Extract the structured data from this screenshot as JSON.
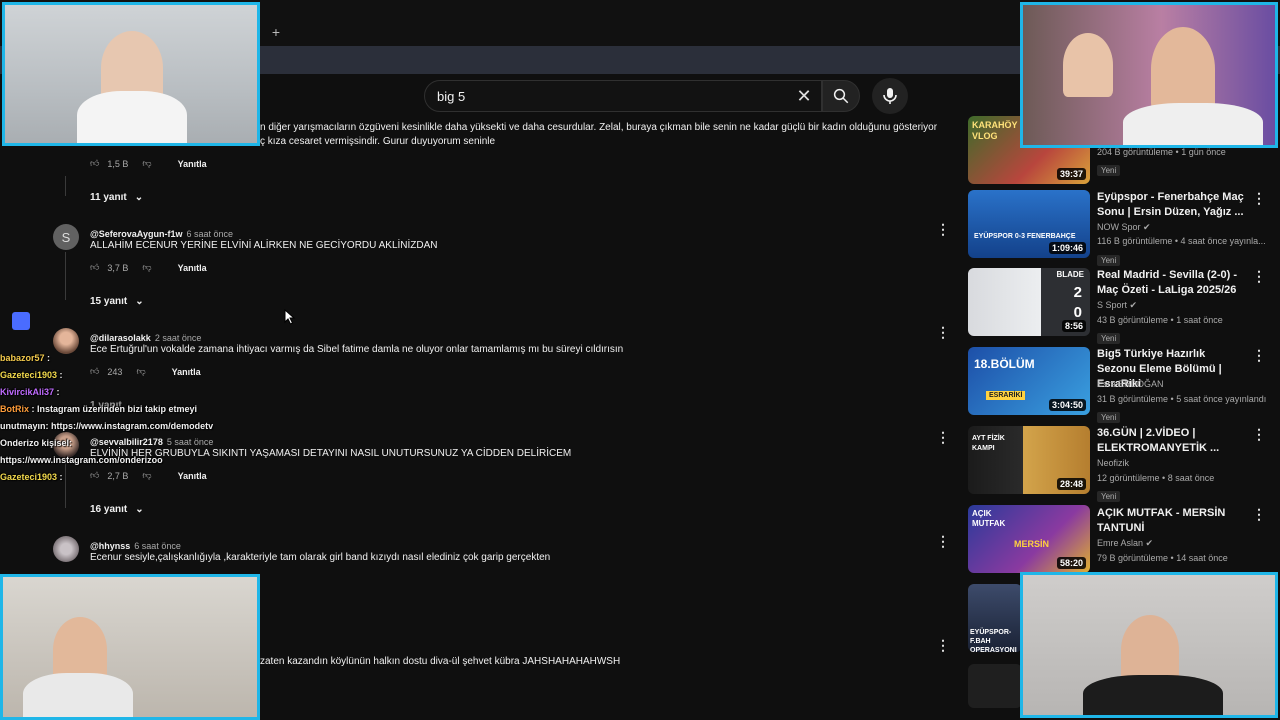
{
  "search": {
    "value": "big 5"
  },
  "comments": [
    {
      "text_line1": "n diğer yarışmacıların özgüveni kesinlikle daha yüksekti ve daha cesurdular. Zelal, buraya çıkman bile senin ne kadar güçlü bir kadın olduğunu gösteriyor",
      "text_line2": "ç kıza cesaret vermişsindir. Gurur duyuyorum seninle",
      "likes": "1,5 B",
      "reply": "Yanıtla",
      "replies": "11 yanıt"
    },
    {
      "handle": "@SeferovaAygun-f1w",
      "time": "6 saat önce",
      "avatar_letter": "S",
      "text": "ALLAHİM ECENUR YERİNE ELVİNİ ALİRKEN NE GECİYORDU AKLİNİZDAN",
      "likes": "3,7 B",
      "reply": "Yanıtla",
      "replies": "15 yanıt"
    },
    {
      "handle": "@dilarasolakk",
      "time": "2 saat önce",
      "text": "Ece Ertuğrul'un vokalde zamana ihtiyacı varmış da Sibel fatime damla ne oluyor onlar tamamlamış mı bu süreyi cıldırısın",
      "likes": "243",
      "reply": "Yanıtla",
      "replies": "1 yanıt"
    },
    {
      "handle": "@sevvalbilir2178",
      "time": "5 saat önce",
      "text": "ELVİNİN HER GRUBUYLA SIKINTI YAŞAMASI DETAYINI NASIL UNUTURSUNUZ YA CİDDEN DELİRİCEM",
      "likes": "2,7 B",
      "reply": "Yanıtla",
      "replies": "16 yanıt"
    },
    {
      "handle": "@hhynss",
      "time": "6 saat önce",
      "text": "Ecenur sesiyle,çalışkanlığıyla ,karakteriyle tam olarak girl band kızıydı nasıl elediniz çok garip gerçekten"
    },
    {
      "text": "zaten kazandın köylünün halkın dostu diva-ül şehvet kübra JAHSHAHAHAHWSH"
    }
  ],
  "sidebar": [
    {
      "thumb_text": "KARAHÖY VLOG",
      "duration": "39:37",
      "meta1": "204 B görüntüleme • 1 gün önce",
      "badge": "Yeni"
    },
    {
      "title": "Eyüpspor - Fenerbahçe Maç Sonu | Ersin Düzen, Yağız ...",
      "channel": "NOW Spor",
      "meta1": "116 B görüntüleme • 4 saat önce yayınla...",
      "badge": "Yeni",
      "duration": "1:09:46",
      "thumb_text": "EYÜPSPOR 0-3 FENERBAHÇE"
    },
    {
      "title": "Real Madrid - Sevilla (2-0) - Maç Özeti - LaLiga 2025/26",
      "channel": "S Sport",
      "meta1": "43 B görüntüleme • 1 saat önce",
      "badge": "Yeni",
      "duration": "8:56",
      "thumb_text": "BLADE",
      "score_home": "2",
      "score_away": "0"
    },
    {
      "title": "Big5 Türkiye Hazırlık Sezonu Eleme Bölümü | EsraRiki",
      "channel": "Esra ERDOĞAN",
      "meta1": "31 B görüntüleme • 5 saat önce yayınlandı",
      "badge": "Yeni",
      "duration": "3:04:50",
      "thumb_text": "18.BÖLÜM",
      "thumb_tag": "ESRARİKİ"
    },
    {
      "title": "36.GÜN | 2.VİDEO | ELEKTROMANYETİK ...",
      "channel": "Neofizik",
      "meta1": "12 görüntüleme • 8 saat önce",
      "badge": "Yeni",
      "duration": "28:48",
      "thumb_text": "AYT FİZİK KAMPI"
    },
    {
      "title": "AÇIK MUTFAK - MERSİN TANTUNİ",
      "channel": "Emre Aslan",
      "meta1": "79 B görüntüleme • 14 saat önce",
      "duration": "58:20",
      "thumb_text": "AÇIK MUTFAK",
      "thumb_tag": "MERSİN"
    },
    {
      "thumb_text": "EYÜPSPOR-F.BAH OPERASYONI"
    }
  ],
  "chat": [
    {
      "user": "babazor57",
      "color": "#f2c94c",
      "msg": ""
    },
    {
      "user": "Gazeteci1903",
      "color": "#f2d94c",
      "msg": ""
    },
    {
      "user": "KivircikAli37",
      "color": "#c06cff",
      "msg": ""
    },
    {
      "user": "BotRix",
      "color": "#ff9d3a",
      "msg": "Instagram üzerinden bizi takip etmeyi"
    },
    {
      "user": "",
      "color": "#ffffff",
      "msg": "unutmayın: https://www.instagram.com/demodetv"
    },
    {
      "user": "",
      "color": "#ffffff",
      "msg": "Onderizo kişisel:"
    },
    {
      "user": "",
      "color": "#ffffff",
      "msg": "https://www.instagram.com/onderizoo"
    },
    {
      "user": "Gazeteci1903",
      "color": "#f2d94c",
      "msg": ""
    }
  ]
}
